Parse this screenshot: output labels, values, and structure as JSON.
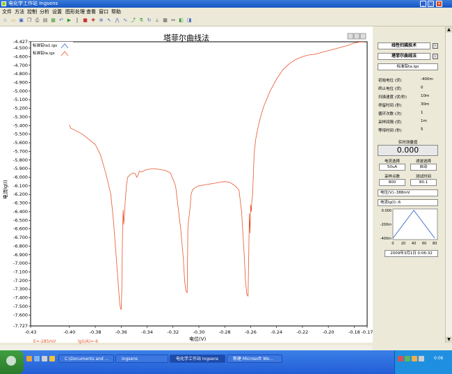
{
  "window": {
    "title": "电化学工作站 Ingsens"
  },
  "menu": [
    "文件",
    "方法",
    "控制",
    "分析",
    "设置",
    "图形处理",
    "查看",
    "窗口",
    "帮助"
  ],
  "toolbar_icons": [
    "new-file-icon",
    "open-icon",
    "save-icon",
    "copy-icon",
    "print-icon",
    "paste-icon",
    "table-icon",
    "undo-icon",
    "run-icon",
    "pause-icon",
    "stop-icon",
    "marker-icon",
    "zoom-icon",
    "cursor-icon",
    "peak-icon",
    "smooth-icon",
    "fit-icon",
    "flask-icon",
    "rotate-icon",
    "axis-icon",
    "grid-icon",
    "range-icon",
    "color-icon",
    "palette-icon"
  ],
  "chart": {
    "title": "塔菲尔曲线法",
    "legend": [
      "标准铅ta1.igs",
      "标准铅ta.igs"
    ],
    "ylabel": "电流lg(I)",
    "xlabel": "电位(V)",
    "status_left": "E=-285mV",
    "status_right": "lg(I/A)=-6"
  },
  "chart_data": {
    "type": "line",
    "xlim": [
      -0.43,
      -0.17
    ],
    "ylim": [
      -7.727,
      -4.427
    ],
    "xticks": [
      -0.43,
      -0.4,
      -0.38,
      -0.36,
      -0.34,
      -0.32,
      -0.3,
      -0.28,
      -0.26,
      -0.24,
      -0.22,
      -0.2,
      -0.18,
      -0.17
    ],
    "xtick_labels": [
      "-0.43",
      "-0.40",
      "-0.38",
      "-0.36",
      "-0.34",
      "-0.32",
      "-0.30",
      "-0.28",
      "-0.26",
      "-0.24",
      "-0.22",
      "-0.20",
      "-0.18",
      "-0.17"
    ],
    "ytick_labels": [
      "-4.427",
      "-4.500",
      "-4.600",
      "-4.700",
      "-4.800",
      "-4.900",
      "-5.000",
      "-5.100",
      "-5.200",
      "-5.300",
      "-5.400",
      "-5.500",
      "-5.600",
      "-5.700",
      "-5.800",
      "-5.900",
      "-6.000",
      "-6.100",
      "-6.200",
      "-6.300",
      "-6.400",
      "-6.500",
      "-6.600",
      "-6.700",
      "-6.800",
      "-6.900",
      "-7.000",
      "-7.100",
      "-7.200",
      "-7.300",
      "-7.400",
      "-7.500",
      "-7.600",
      "-7.727"
    ],
    "yticks": [
      -4.427,
      -4.5,
      -4.6,
      -4.7,
      -4.8,
      -4.9,
      -5.0,
      -5.1,
      -5.2,
      -5.3,
      -5.4,
      -5.5,
      -5.6,
      -5.7,
      -5.8,
      -5.9,
      -6.0,
      -6.1,
      -6.2,
      -6.3,
      -6.4,
      -6.5,
      -6.6,
      -6.7,
      -6.8,
      -6.9,
      -7.0,
      -7.1,
      -7.2,
      -7.3,
      -7.4,
      -7.5,
      -7.6,
      -7.727
    ],
    "series": [
      {
        "name": "标准铅ta.igs",
        "color": "#e8542a",
        "x": [
          -0.4,
          -0.399,
          -0.395,
          -0.39,
          -0.385,
          -0.38,
          -0.376,
          -0.372,
          -0.368,
          -0.366,
          -0.364,
          -0.362,
          -0.361,
          -0.36,
          -0.3595,
          -0.359,
          -0.3585,
          -0.358,
          -0.357,
          -0.356,
          -0.355,
          -0.353,
          -0.351,
          -0.349,
          -0.348,
          -0.347,
          -0.346,
          -0.344,
          -0.342,
          -0.34,
          -0.335,
          -0.33,
          -0.326,
          -0.322,
          -0.318,
          -0.316,
          -0.314,
          -0.312,
          -0.311,
          -0.31,
          -0.309,
          -0.3085,
          -0.308,
          -0.3075,
          -0.307,
          -0.3065,
          -0.306,
          -0.305,
          -0.303,
          -0.3,
          -0.296,
          -0.292,
          -0.288,
          -0.284,
          -0.28,
          -0.276,
          -0.272,
          -0.269,
          -0.267,
          -0.265,
          -0.264,
          -0.263,
          -0.262,
          -0.2615,
          -0.261,
          -0.2605,
          -0.26,
          -0.2595,
          -0.259,
          -0.2585,
          -0.258,
          -0.2575,
          -0.257,
          -0.256,
          -0.254,
          -0.252,
          -0.25,
          -0.245,
          -0.24,
          -0.235,
          -0.23,
          -0.225,
          -0.22,
          -0.215,
          -0.21,
          -0.205,
          -0.2,
          -0.195,
          -0.19,
          -0.185,
          -0.18,
          -0.176,
          -0.172
        ],
        "y": [
          -5.39,
          -5.43,
          -5.46,
          -5.5,
          -5.56,
          -5.62,
          -5.74,
          -5.95,
          -6.2,
          -6.5,
          -6.9,
          -7.3,
          -7.49,
          -7.54,
          -7.3,
          -6.65,
          -6.38,
          -6.55,
          -6.3,
          -6.1,
          -6.0,
          -5.97,
          -5.95,
          -5.96,
          -6.0,
          -5.98,
          -5.93,
          -5.94,
          -5.92,
          -5.91,
          -5.9,
          -5.91,
          -5.92,
          -5.95,
          -6.1,
          -6.35,
          -6.6,
          -6.95,
          -7.2,
          -7.32,
          -7.34,
          -6.6,
          -6.5,
          -6.45,
          -6.38,
          -6.3,
          -6.2,
          -6.15,
          -6.12,
          -6.1,
          -6.09,
          -6.08,
          -6.07,
          -6.06,
          -6.05,
          -6.06,
          -6.1,
          -6.15,
          -6.4,
          -6.9,
          -7.2,
          -7.36,
          -7.38,
          -6.9,
          -6.42,
          -6.65,
          -6.32,
          -6.4,
          -6.26,
          -6.2,
          -6.0,
          -5.8,
          -5.68,
          -5.55,
          -5.4,
          -5.28,
          -5.18,
          -5.0,
          -4.86,
          -4.75,
          -4.68,
          -4.63,
          -4.6,
          -4.58,
          -4.57,
          -4.55,
          -4.53,
          -4.51,
          -4.49,
          -4.47,
          -4.44,
          -4.43,
          -4.43
        ]
      }
    ]
  },
  "panel": {
    "btn_linear_sweep": "线性扫描技术",
    "btn_tafel": "塔菲尔曲线法",
    "file_name": "标准铅ta.igs",
    "params": [
      {
        "label": "初始电位 (伏)",
        "value": "-400m"
      },
      {
        "label": "终止电位 (伏)",
        "value": "0"
      },
      {
        "label": "扫描速度 (伏/秒)",
        "value": "10m"
      },
      {
        "label": "停留时间 (秒)",
        "value": "30m"
      },
      {
        "label": "循环次数 (次)",
        "value": "1"
      },
      {
        "label": "采样间隔 (伏)",
        "value": "1m"
      },
      {
        "label": "等待时间 (秒)",
        "value": "5"
      }
    ],
    "realtime_label": "实时测量值",
    "realtime_value": "0.000",
    "current_select_label": "电流选择",
    "filter_select_label": "滤波选择",
    "current_select_value": "50uA",
    "filter_select_value": "自动",
    "sample_count_label": "采样点数",
    "measure_time_label": "测试时间",
    "sample_count_value": "800",
    "measure_time_value": "80.1",
    "potential_readout": "电位(V):-388mV",
    "current_readout": "电流lg(I):-6",
    "mini_chart_yticks": [
      "0.000",
      "-200m",
      "-400m"
    ],
    "mini_chart_xticks": [
      "0",
      "20",
      "40",
      "60",
      "80"
    ],
    "datetime": "2009年3月1日    0:06:32"
  },
  "mini_chart_data": {
    "type": "line",
    "x": [
      0,
      40,
      80
    ],
    "y": [
      -400,
      0,
      -400
    ],
    "color": "#3a64c8"
  },
  "taskbar": {
    "start_label": "开始",
    "tasks": [
      "C:\\Documents and ...",
      "ingsens",
      "电化学工作站 Ingsens",
      "新建 Microsoft Wo..."
    ],
    "clock": "0:06"
  }
}
